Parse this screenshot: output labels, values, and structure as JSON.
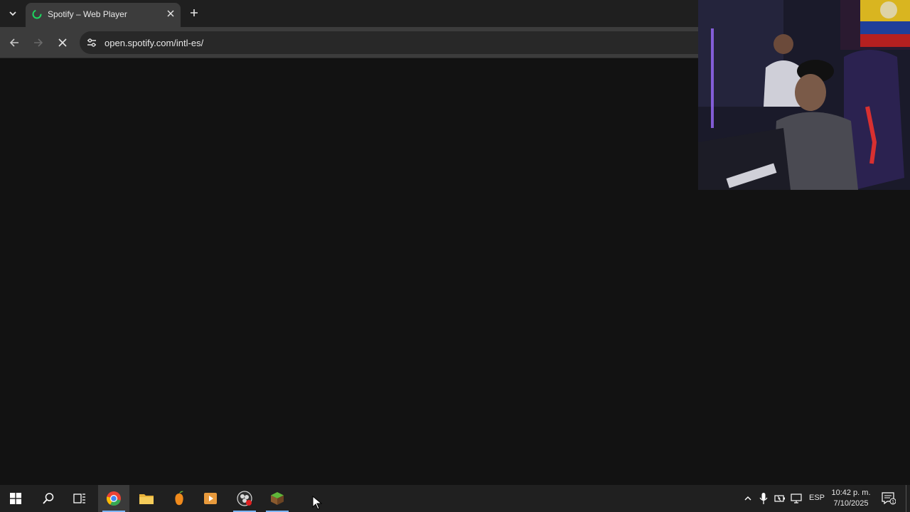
{
  "browser": {
    "tab": {
      "title": "Spotify – Web Player",
      "favicon": "loading-spinner-icon",
      "close_icon": "close-icon"
    },
    "tab_search_icon": "chevron-down-icon",
    "new_tab_icon": "plus-icon",
    "toolbar": {
      "back_icon": "arrow-left-icon",
      "forward_icon": "arrow-right-icon",
      "stop_icon": "close-icon",
      "site_info_icon": "tune-icon",
      "url": "open.spotify.com/intl-es/"
    }
  },
  "page": {
    "background": "#121212",
    "state": "loading"
  },
  "webcam_overlay": {
    "description_icon": "webcam-feed"
  },
  "taskbar": {
    "start_icon": "windows-logo-icon",
    "search_icon": "search-icon",
    "task_view_icon": "task-view-icon",
    "apps": [
      {
        "name": "Google Chrome",
        "icon": "chrome-icon",
        "active": true
      },
      {
        "name": "File Explorer",
        "icon": "folder-icon",
        "active": false
      },
      {
        "name": "FL Studio",
        "icon": "fruit-icon",
        "active": false
      },
      {
        "name": "Media Player",
        "icon": "media-player-icon",
        "active": false
      },
      {
        "name": "OBS Studio",
        "icon": "obs-icon",
        "active": true
      },
      {
        "name": "Minecraft",
        "icon": "minecraft-block-icon",
        "active": true
      }
    ],
    "tray": {
      "overflow_icon": "chevron-up-icon",
      "mic_icon": "microphone-icon",
      "battery_icon": "power-icon",
      "network_icon": "network-icon",
      "language": "ESP",
      "time": "10:42 p. m.",
      "date": "7/10/2025",
      "notification_count": "1"
    }
  },
  "colors": {
    "tabstrip": "#1f1f1f",
    "toolbar": "#3c3c3c",
    "omnibox": "#282828",
    "content": "#121212",
    "taskbar": "#202020",
    "spotify_green": "#1ed760",
    "chrome_red": "#ea4335",
    "chrome_yellow": "#fbbc05",
    "chrome_green": "#34a853",
    "chrome_blue": "#4285f4"
  }
}
